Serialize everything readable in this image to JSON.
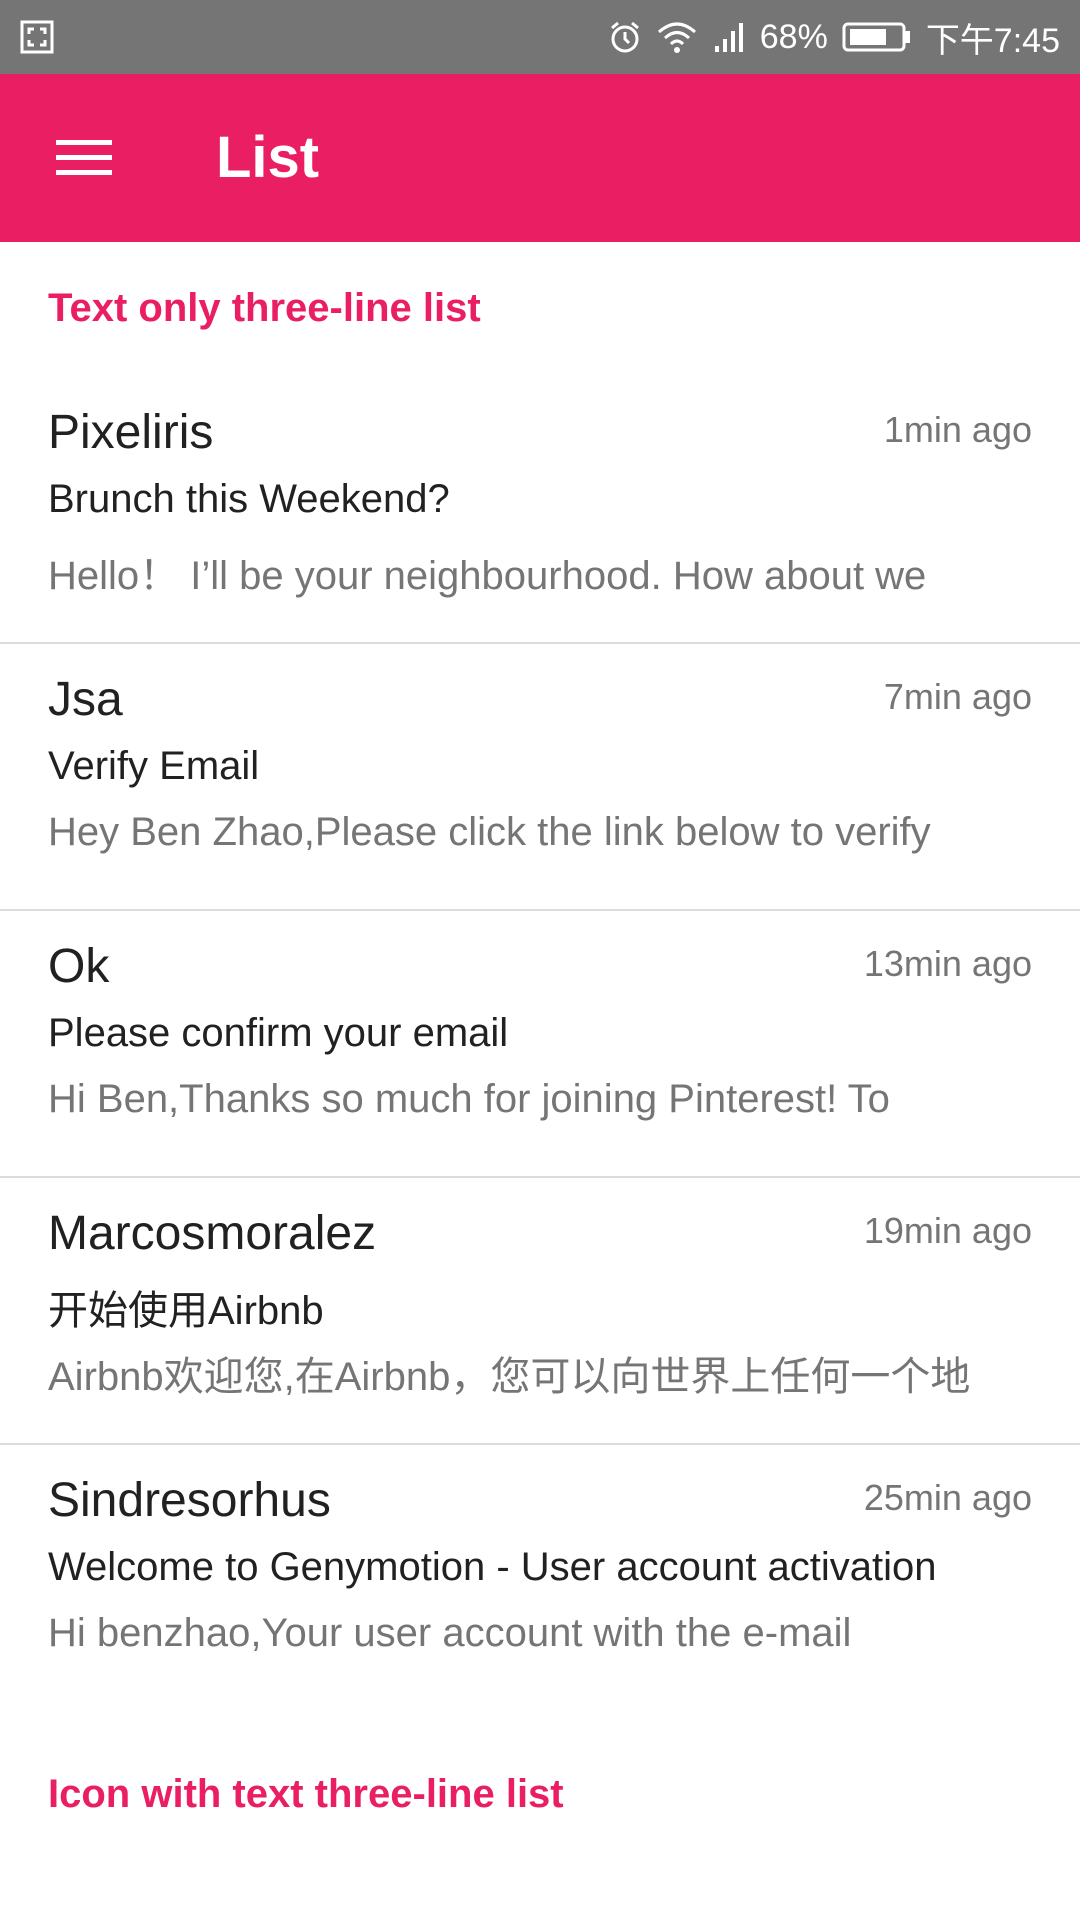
{
  "status_bar": {
    "icons": [
      "screenshot-icon",
      "alarm-icon",
      "wifi-icon",
      "signal-icon",
      "battery-icon"
    ],
    "battery": "68%",
    "time": "下午7:45"
  },
  "app_bar": {
    "menu_icon": "hamburger-menu-icon",
    "title": "List",
    "color": "#e91e63"
  },
  "sections": [
    {
      "header": "Text only three-line list",
      "items": [
        {
          "title": "Pixeliris",
          "time": "1min ago",
          "subject": "Brunch this Weekend?",
          "preview": "Hello！ I’ll be your neighbourhood. How about we"
        },
        {
          "title": "Jsa",
          "time": "7min ago",
          "subject": "Verify Email",
          "preview": "Hey Ben Zhao,Please click the link below to verify"
        },
        {
          "title": "Ok",
          "time": "13min ago",
          "subject": "Please confirm your email",
          "preview": "Hi Ben,Thanks so much for joining Pinterest! To"
        },
        {
          "title": "Marcosmoralez",
          "time": "19min ago",
          "subject": "开始使用Airbnb",
          "preview": "Airbnb欢迎您,在Airbnb，您可以向世界上任何一个地"
        },
        {
          "title": "Sindresorhus",
          "time": "25min ago",
          "subject": "Welcome to Genymotion - User account activation",
          "preview": "Hi benzhao,Your user account with the e-mail"
        }
      ]
    },
    {
      "header": "Icon with text three-line list"
    }
  ]
}
